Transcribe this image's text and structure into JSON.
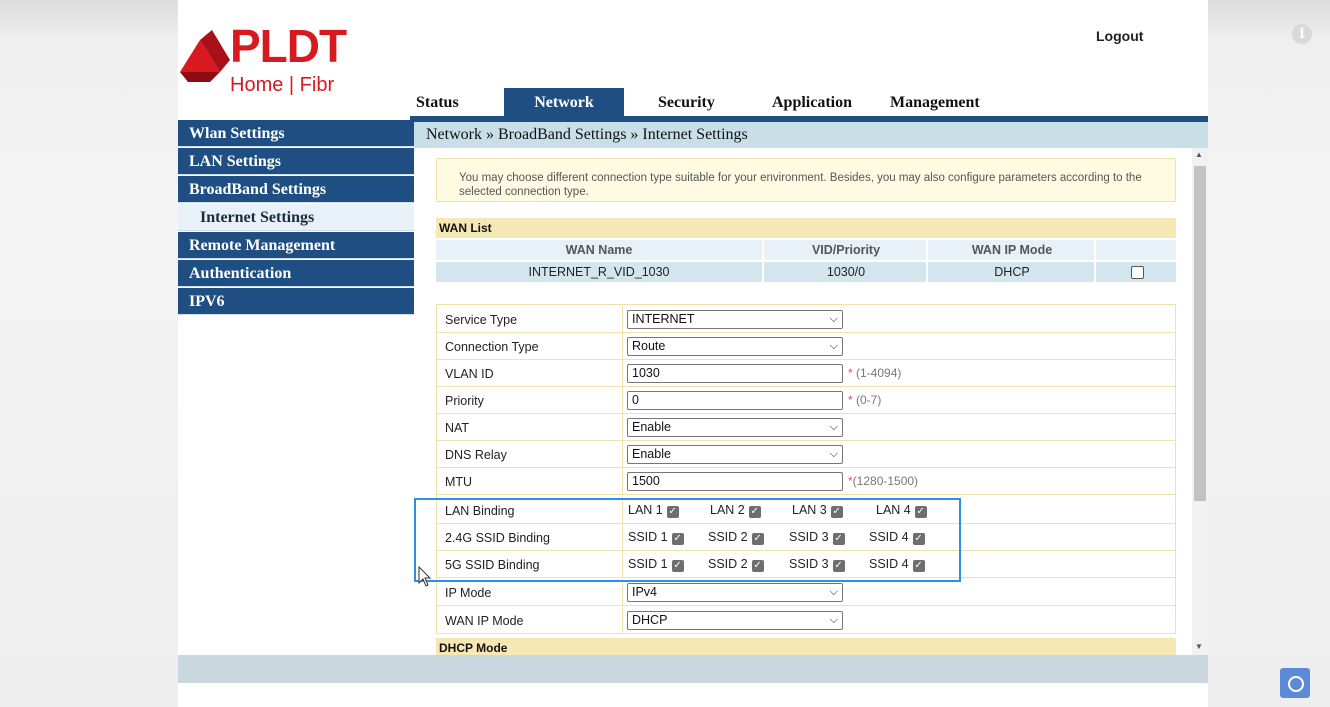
{
  "brand": {
    "name": "PLDT",
    "subtitle": "Home | Fibr",
    "color": "#d71920"
  },
  "header": {
    "logout_label": "Logout",
    "info_icon": "info-icon"
  },
  "tabs": [
    {
      "label": "Status"
    },
    {
      "label": "Network",
      "active": true
    },
    {
      "label": "Security"
    },
    {
      "label": "Application"
    },
    {
      "label": "Management"
    }
  ],
  "sidebar": {
    "items": [
      {
        "label": "Wlan Settings"
      },
      {
        "label": "LAN Settings"
      },
      {
        "label": "BroadBand Settings"
      },
      {
        "label": "Internet Settings",
        "selected": true
      },
      {
        "label": "Remote Management"
      },
      {
        "label": "Authentication"
      },
      {
        "label": "IPV6"
      }
    ]
  },
  "breadcrumb": "Network » BroadBand Settings » Internet Settings",
  "notice": "You may choose different connection type suitable for your environment. Besides, you may also configure parameters according to the selected connection type.",
  "wan_list": {
    "title": "WAN List",
    "headers": [
      "WAN Name",
      "VID/Priority",
      "WAN IP Mode",
      ""
    ],
    "rows": [
      {
        "name": "INTERNET_R_VID_1030",
        "vid_priority": "1030/0",
        "ip_mode": "DHCP",
        "checked": false
      }
    ]
  },
  "form": {
    "service_type": {
      "label": "Service Type",
      "value": "INTERNET"
    },
    "connection_type": {
      "label": "Connection Type",
      "value": "Route"
    },
    "vlan_id": {
      "label": "VLAN ID",
      "value": "1030",
      "hint": "(1-4094)"
    },
    "priority": {
      "label": "Priority",
      "value": "0",
      "hint": "(0-7)"
    },
    "nat": {
      "label": "NAT",
      "value": "Enable"
    },
    "dns_relay": {
      "label": "DNS Relay",
      "value": "Enable"
    },
    "mtu": {
      "label": "MTU",
      "value": "1500",
      "hint": "(1280-1500)"
    },
    "lan_binding": {
      "label": "LAN Binding",
      "options": [
        "LAN 1",
        "LAN 2",
        "LAN 3",
        "LAN 4"
      ]
    },
    "ssid24_binding": {
      "label": "2.4G SSID Binding",
      "options": [
        "SSID 1",
        "SSID 2",
        "SSID 3",
        "SSID 4"
      ]
    },
    "ssid5_binding": {
      "label": "5G SSID Binding",
      "options": [
        "SSID 1",
        "SSID 2",
        "SSID 3",
        "SSID 4"
      ]
    },
    "ip_mode": {
      "label": "IP Mode",
      "value": "IPv4"
    },
    "wan_ip_mode": {
      "label": "WAN IP Mode",
      "value": "DHCP"
    },
    "required_mark": "*"
  },
  "dhcp_mode_title": "DHCP Mode",
  "colors": {
    "nav": "#1f4f82",
    "highlight": "#2f8fe6"
  }
}
